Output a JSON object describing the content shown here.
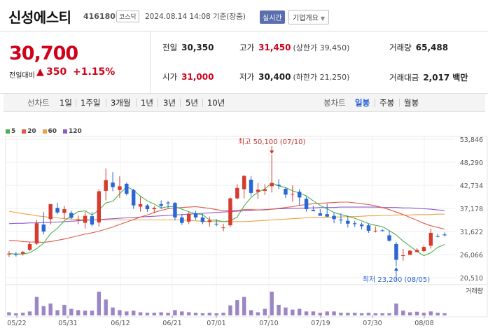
{
  "header": {
    "name": "신성에스티",
    "code": "416180",
    "market": "코스닥",
    "datetime": "2024.08.14 14:08 기준(장중)",
    "realtime_btn": "실시간",
    "company_info_btn": "기업개요"
  },
  "price": {
    "current": "30,700",
    "change_label": "전일대비",
    "change_arrow": "▲",
    "change_value": "350",
    "change_pct": "+1.15%"
  },
  "stats": {
    "prev_close": {
      "label": "전일",
      "value": "30,350"
    },
    "open": {
      "label": "시가",
      "value": "31,000"
    },
    "high": {
      "label": "고가",
      "value": "31,450",
      "sub": "(상한가 39,450)"
    },
    "low": {
      "label": "저가",
      "value": "30,400",
      "sub": "(하한가 21,250)"
    },
    "volume": {
      "label": "거래량",
      "value": "65,488"
    },
    "amount": {
      "label": "거래대금",
      "value": "2,017",
      "unit": "백만"
    }
  },
  "tabs": {
    "line_label": "선차트",
    "periods": [
      "1일",
      "1주일",
      "3개월",
      "1년",
      "3년",
      "5년",
      "10년"
    ],
    "candle_label": "봉차트",
    "candle_tabs": [
      "일봉",
      "주봉",
      "월봉"
    ],
    "active_candle": "일봉"
  },
  "chart_data": {
    "type": "candlestick",
    "legend": [
      "5",
      "20",
      "60",
      "120"
    ],
    "legend_colors": [
      "#4caf50",
      "#e05a4a",
      "#f0a040",
      "#8a5ccf"
    ],
    "y_ticks": [
      "53,846",
      "48,290",
      "42,734",
      "37,178",
      "31,622",
      "26,066",
      "20,510"
    ],
    "y_tick_values": [
      53846,
      48290,
      42734,
      37178,
      31622,
      26066,
      20510
    ],
    "x_labels": [
      "05/22",
      "05/31",
      "06/12",
      "06/21",
      "07/01",
      "07/10",
      "07/19",
      "07/30",
      "08/08"
    ],
    "volume_label": "거래량",
    "max_annotation": "최고 50,100 (07/10)",
    "min_annotation": "최저 23,200 (08/05)",
    "candles": [
      [
        26100,
        26900,
        25500,
        26300
      ],
      [
        26200,
        26700,
        25600,
        26000
      ],
      [
        26300,
        26900,
        25800,
        26700
      ],
      [
        27200,
        29100,
        26900,
        28600
      ],
      [
        28700,
        34400,
        28400,
        33600
      ],
      [
        33300,
        36300,
        30900,
        31600
      ],
      [
        34600,
        38300,
        33300,
        38200
      ],
      [
        37300,
        38500,
        35800,
        36200
      ],
      [
        36100,
        37800,
        34600,
        37000
      ],
      [
        36100,
        36600,
        34500,
        34900
      ],
      [
        34400,
        35500,
        33400,
        34500
      ],
      [
        33700,
        36400,
        32300,
        35400
      ],
      [
        35300,
        36300,
        32800,
        33300
      ],
      [
        33800,
        41800,
        32800,
        41300
      ],
      [
        41400,
        46800,
        39100,
        44000
      ],
      [
        43400,
        45900,
        41300,
        42300
      ],
      [
        41600,
        44900,
        39700,
        42500
      ],
      [
        43100,
        43400,
        40300,
        40700
      ],
      [
        41600,
        41900,
        37100,
        37900
      ],
      [
        37600,
        40000,
        36400,
        38200
      ],
      [
        37900,
        38200,
        36300,
        37000
      ],
      [
        37000,
        37700,
        36000,
        37300
      ],
      [
        38200,
        39100,
        37000,
        37800
      ],
      [
        38600,
        39000,
        37100,
        38400
      ],
      [
        38500,
        38700,
        34300,
        35000
      ],
      [
        35000,
        35800,
        33200,
        33700
      ],
      [
        34000,
        36300,
        33400,
        35900
      ],
      [
        36000,
        36600,
        34400,
        35000
      ],
      [
        35000,
        35900,
        33400,
        33900
      ],
      [
        33900,
        35200,
        32800,
        34300
      ],
      [
        33500,
        34600,
        32900,
        33300
      ],
      [
        32500,
        33500,
        31700,
        32600
      ],
      [
        33100,
        39800,
        32800,
        39600
      ],
      [
        39600,
        43000,
        39400,
        42100
      ],
      [
        41800,
        45200,
        39600,
        45000
      ],
      [
        44100,
        45000,
        40100,
        40900
      ],
      [
        41200,
        43300,
        39500,
        41700
      ],
      [
        41400,
        43000,
        40400,
        41800
      ],
      [
        42500,
        50100,
        41000,
        43300
      ],
      [
        42900,
        44200,
        41800,
        42600
      ],
      [
        41900,
        42300,
        39700,
        40500
      ],
      [
        40700,
        42700,
        38800,
        40700
      ],
      [
        41200,
        41800,
        37900,
        39800
      ],
      [
        39500,
        40000,
        36400,
        37000
      ],
      [
        36800,
        37800,
        36500,
        36500
      ],
      [
        36000,
        37000,
        35600,
        35400
      ],
      [
        35800,
        38300,
        35100,
        35200
      ],
      [
        35400,
        36200,
        33600,
        34600
      ],
      [
        34500,
        36000,
        33500,
        34300
      ],
      [
        34200,
        35400,
        32600,
        33500
      ],
      [
        33600,
        34200,
        32700,
        33400
      ],
      [
        33300,
        33800,
        32100,
        32900
      ],
      [
        33100,
        33500,
        31300,
        31800
      ],
      [
        31800,
        32800,
        31400,
        31800
      ],
      [
        31900,
        32200,
        31600,
        31800
      ],
      [
        30700,
        31800,
        29200,
        29400
      ],
      [
        28600,
        29100,
        23200,
        24800
      ],
      [
        25800,
        27400,
        24600,
        25900
      ],
      [
        26000,
        27200,
        26000,
        27000
      ],
      [
        26700,
        27600,
        26600,
        27200
      ],
      [
        26900,
        28300,
        26600,
        27900
      ],
      [
        28200,
        32300,
        27500,
        31300
      ],
      [
        30500,
        31100,
        30200,
        30400
      ],
      [
        30900,
        31400,
        30400,
        30700
      ]
    ],
    "volumes": [
      12,
      8,
      10,
      15,
      70,
      35,
      45,
      20,
      40,
      25,
      20,
      18,
      18,
      90,
      60,
      30,
      20,
      15,
      18,
      12,
      10,
      10,
      12,
      10,
      20,
      15,
      12,
      10,
      8,
      10,
      8,
      10,
      38,
      58,
      70,
      20,
      12,
      25,
      90,
      40,
      30,
      22,
      25,
      15,
      15,
      10,
      15,
      15,
      10,
      10,
      10,
      8,
      10,
      8,
      8,
      8,
      45,
      18,
      12,
      14,
      10,
      15,
      10,
      8
    ],
    "ma5": [
      26300,
      26200,
      26200,
      26500,
      27500,
      28800,
      31100,
      32400,
      34200,
      35400,
      36400,
      36600,
      35600,
      36800,
      38500,
      38900,
      40700,
      42400,
      41600,
      40100,
      39000,
      38200,
      37300,
      37600,
      37600,
      37000,
      36400,
      35900,
      35700,
      34400,
      34300,
      34000,
      34200,
      35100,
      37800,
      39800,
      41100,
      41900,
      43300,
      42600,
      42200,
      41400,
      40900,
      40200,
      39000,
      37900,
      37100,
      36200,
      35700,
      35300,
      34800,
      34200,
      33500,
      33100,
      32800,
      31800,
      30800,
      29300,
      28100,
      26800,
      25800,
      26500,
      27800,
      28500
    ],
    "ma20": [
      29500,
      29400,
      29200,
      29100,
      29100,
      29000,
      29200,
      29500,
      29800,
      30200,
      30600,
      31000,
      31300,
      31700,
      32200,
      32700,
      33300,
      33900,
      34500,
      35100,
      35600,
      36200,
      36700,
      37100,
      37300,
      37400,
      37500,
      37600,
      37400,
      37200,
      36900,
      36600,
      36600,
      36700,
      36900,
      36900,
      36800,
      36800,
      37000,
      37200,
      37400,
      37600,
      37900,
      38100,
      38300,
      38400,
      38500,
      38600,
      38700,
      38700,
      38500,
      38300,
      38100,
      37800,
      37400,
      36900,
      36300,
      35700,
      35000,
      34300,
      33600,
      33000,
      32600,
      32200
    ],
    "ma60": [
      36500,
      36200,
      35900,
      35700,
      35400,
      35200,
      35000,
      34900,
      34700,
      34600,
      34500,
      34500,
      34400,
      34400,
      34400,
      34400,
      34400,
      34400,
      34400,
      34400,
      34400,
      34400,
      34400,
      34400,
      34400,
      34400,
      34300,
      34200,
      34100,
      34000,
      34000,
      34000,
      34000,
      34000,
      34000,
      34100,
      34200,
      34300,
      34400,
      34500,
      34600,
      34700,
      34800,
      34900,
      35000,
      35000,
      35000,
      35100,
      35100,
      35200,
      35200,
      35300,
      35400,
      35400,
      35500,
      35500,
      35600,
      35600,
      35600,
      35700,
      35700,
      35700,
      35800,
      35800
    ],
    "ma120": [
      33500,
      33600,
      33600,
      33700,
      33700,
      33800,
      33800,
      33900,
      34000,
      34100,
      34200,
      34300,
      34400,
      34500,
      34600,
      34700,
      34800,
      34900,
      35000,
      35100,
      35200,
      35300,
      35400,
      35500,
      35600,
      35700,
      35800,
      35900,
      36000,
      36100,
      36200,
      36300,
      36400,
      36500,
      36600,
      36700,
      36800,
      36900,
      37000,
      37100,
      37100,
      37200,
      37200,
      37300,
      37300,
      37400,
      37400,
      37400,
      37500,
      37500,
      37500,
      37500,
      37500,
      37500,
      37400,
      37400,
      37400,
      37300,
      37300,
      37200,
      37100,
      37000,
      36800,
      36700
    ]
  }
}
